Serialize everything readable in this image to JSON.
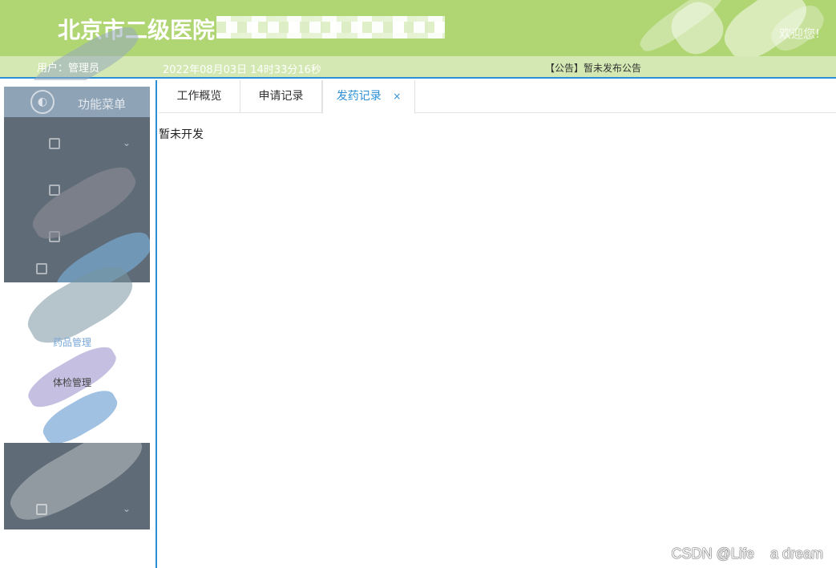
{
  "header": {
    "brand": "北京市二级医院",
    "welcome": "欢迎您!"
  },
  "subbar": {
    "user_label": "用户：管理员",
    "datetime": "2022年08月03日 14时33分16秒",
    "notice": "【公告】暂未发布公告"
  },
  "sidebar": {
    "menu_title": "功能菜单",
    "light_label": "药品管理",
    "dark_label": "体检管理"
  },
  "tabs": [
    {
      "label": "工作概览",
      "active": false
    },
    {
      "label": "申请记录",
      "active": false
    },
    {
      "label": "发药记录",
      "active": true,
      "close": "×"
    }
  ],
  "content": {
    "message": "暂未开发"
  },
  "watermark": "CSDN @Life    a dream",
  "colors": {
    "header_green": "#b0d673",
    "subbar_green": "#d3e8b2",
    "accent_blue": "#2b8fd6",
    "sidebar_slate": "#5f6b77"
  }
}
